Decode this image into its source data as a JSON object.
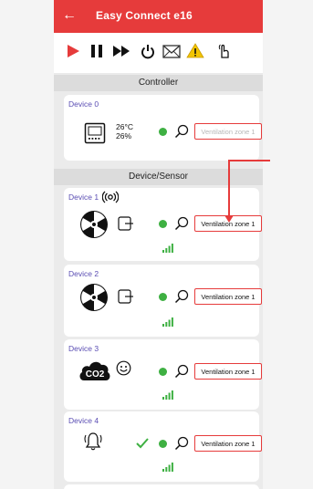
{
  "app": {
    "title": "Easy Connect e16",
    "back_icon": "arrow-left-icon"
  },
  "colors": {
    "brand": "#e63b3b",
    "status_ok": "#3eb042",
    "label": "#5a4db3",
    "warning": "#f2c500"
  },
  "toolbar": {
    "icons": [
      "play-icon",
      "pause-icon",
      "fast-forward-icon",
      "power-icon",
      "mail-icon",
      "warning-icon",
      "touch-hand-icon"
    ]
  },
  "sections": {
    "controller": "Controller",
    "devices": "Device/Sensor"
  },
  "controller": {
    "label": "Device 0",
    "temperature": "26°C",
    "humidity": "26%",
    "zone": "Ventilation zone 1"
  },
  "devices": [
    {
      "label": "Device 1",
      "icon": "fan-icon",
      "zone": "Ventilation zone 1",
      "extra_icon": "wireless-icon"
    },
    {
      "label": "Device 2",
      "icon": "fan-icon",
      "zone": "Ventilation zone 1"
    },
    {
      "label": "Device 3",
      "icon": "co2-cloud-icon",
      "icon_text": "CO2",
      "zone": "Ventilation zone 1"
    },
    {
      "label": "Device 4",
      "icon": "bell-icon",
      "zone": "Ventilation zone 1"
    }
  ]
}
